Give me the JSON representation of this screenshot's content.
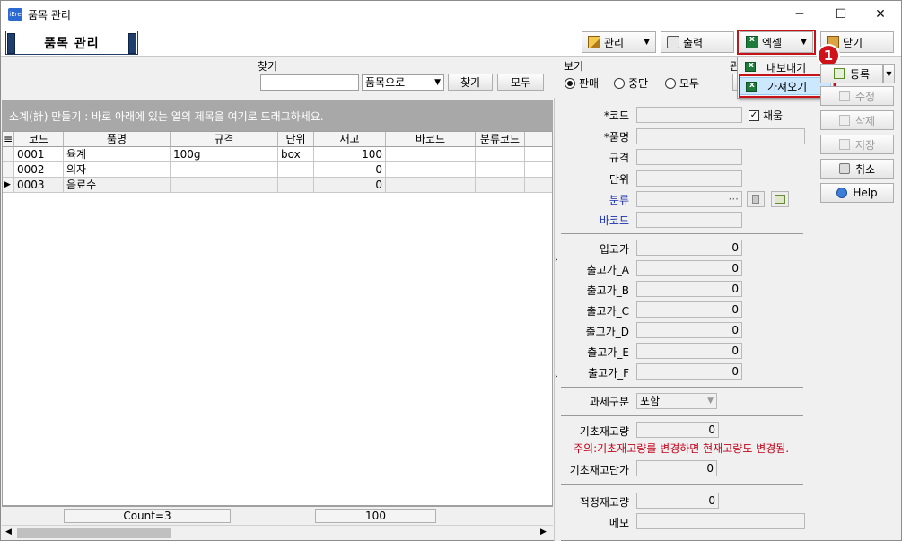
{
  "window": {
    "app_icon": "iEre",
    "title": "품목 관리",
    "controls": {
      "minimize": "─",
      "maximize": "☐",
      "close": "✕"
    }
  },
  "header": {
    "form_title": "품목 관리",
    "manage_label": "관리",
    "print_label": "출력",
    "excel_label": "엑셀",
    "close_label": "닫기"
  },
  "excel_menu": {
    "items": [
      "내보내기",
      "가져오기"
    ],
    "highlighted": "가져오기",
    "badge": "1"
  },
  "search": {
    "find_label": "찾기",
    "find_value": "",
    "find_by": "품목으로",
    "find_button": "찾기",
    "all_button": "모두",
    "view_label": "보기",
    "view_options": [
      "판매",
      "중단",
      "모두"
    ],
    "view_selected": "판매",
    "extra_label": "관"
  },
  "grid": {
    "group_hint": "소계(計) 만들기 : 바로 아래에 있는 열의 제목을 여기로 드래그하세요.",
    "columns": [
      "코드",
      "품명",
      "규격",
      "단위",
      "재고",
      "바코드",
      "분류코드"
    ],
    "rows": [
      {
        "code": "0001",
        "name": "육계",
        "spec": "100g",
        "unit": "box",
        "stock": "100",
        "barcode": "",
        "category": ""
      },
      {
        "code": "0002",
        "name": "의자",
        "spec": "",
        "unit": "",
        "stock": "0",
        "barcode": "",
        "category": ""
      },
      {
        "code": "0003",
        "name": "음료수",
        "spec": "",
        "unit": "",
        "stock": "0",
        "barcode": "",
        "category": ""
      }
    ],
    "current_row_marker": "▶",
    "footer_count": "Count=3",
    "footer_stock_sum": "100"
  },
  "detail": {
    "code_label": "*코드",
    "use_label": "채움",
    "name_label": "*품명",
    "spec_label": "규격",
    "unit_label": "단위",
    "category_label": "분류",
    "barcode_label": "바코드",
    "prices": [
      {
        "label": "입고가",
        "value": "0"
      },
      {
        "label": "출고가_A",
        "value": "0"
      },
      {
        "label": "출고가_B",
        "value": "0"
      },
      {
        "label": "출고가_C",
        "value": "0"
      },
      {
        "label": "출고가_D",
        "value": "0"
      },
      {
        "label": "출고가_E",
        "value": "0"
      },
      {
        "label": "출고가_F",
        "value": "0"
      }
    ],
    "tax_label": "과세구분",
    "tax_value": "포함",
    "base_stock_label": "기초재고량",
    "base_stock_value": "0",
    "warning": "주의:기초재고량를 변경하면 현재고량도 변경됨.",
    "base_cost_label": "기초재고단가",
    "base_cost_value": "0",
    "proper_stock_label": "적정재고량",
    "proper_stock_value": "0",
    "memo_label": "메모"
  },
  "actions": {
    "register": "등록",
    "edit": "수정",
    "delete": "삭제",
    "save": "저장",
    "cancel": "취소",
    "help": "Help"
  },
  "colors": {
    "highlight_red": "#c8121a",
    "label_blue": "#1a2fb0",
    "group_bar": "#a8a8a8"
  }
}
